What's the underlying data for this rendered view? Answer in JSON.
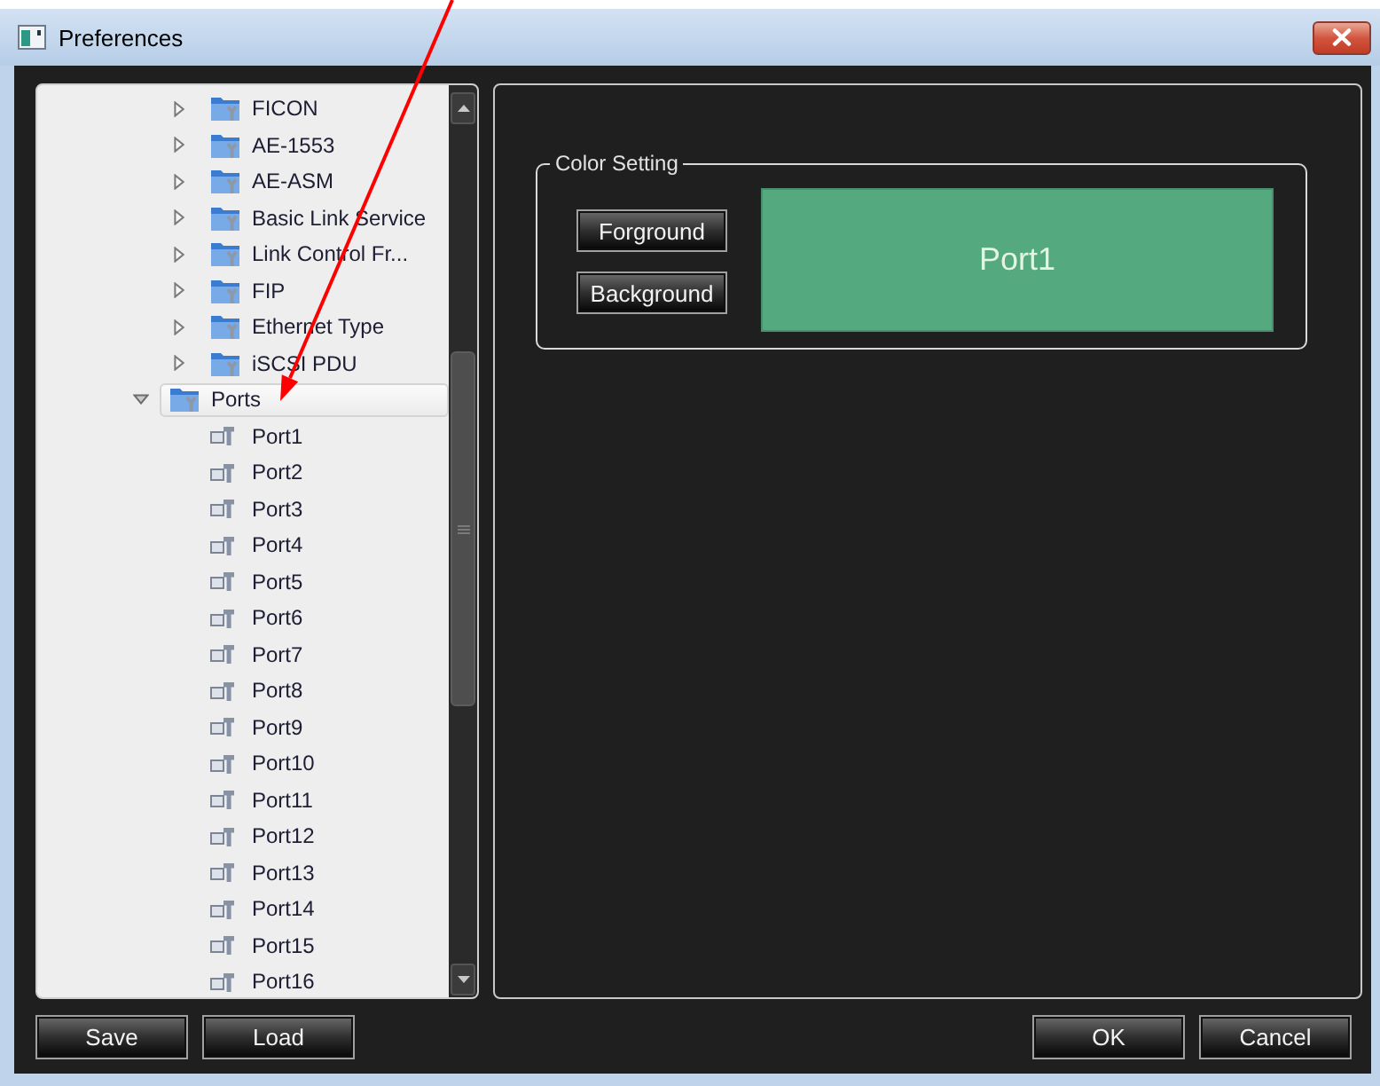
{
  "window": {
    "title": "Preferences"
  },
  "tree": {
    "items": [
      {
        "children": [
          {
            "label": "FICON",
            "kind": "folder",
            "expanded": false,
            "selected": false
          },
          {
            "label": "AE-1553",
            "kind": "folder",
            "expanded": false,
            "selected": false
          },
          {
            "label": "AE-ASM",
            "kind": "folder",
            "expanded": false,
            "selected": false
          },
          {
            "label": "Basic Link Service",
            "kind": "folder",
            "expanded": false,
            "selected": false
          },
          {
            "label": "Link Control Fr...",
            "kind": "folder",
            "expanded": false,
            "selected": false
          },
          {
            "label": "FIP",
            "kind": "folder",
            "expanded": false,
            "selected": false
          },
          {
            "label": "Ethernet Type",
            "kind": "folder",
            "expanded": false,
            "selected": false
          },
          {
            "label": "iSCSI PDU",
            "kind": "folder",
            "expanded": false,
            "selected": false
          }
        ]
      },
      {
        "label": "Ports",
        "kind": "folder",
        "expanded": true,
        "selected": true,
        "children": [
          {
            "label": "Port1",
            "kind": "port",
            "selected": false
          },
          {
            "label": "Port2",
            "kind": "port",
            "selected": false
          },
          {
            "label": "Port3",
            "kind": "port",
            "selected": false
          },
          {
            "label": "Port4",
            "kind": "port",
            "selected": false
          },
          {
            "label": "Port5",
            "kind": "port",
            "selected": false
          },
          {
            "label": "Port6",
            "kind": "port",
            "selected": false
          },
          {
            "label": "Port7",
            "kind": "port",
            "selected": false
          },
          {
            "label": "Port8",
            "kind": "port",
            "selected": false
          },
          {
            "label": "Port9",
            "kind": "port",
            "selected": false
          },
          {
            "label": "Port10",
            "kind": "port",
            "selected": false
          },
          {
            "label": "Port11",
            "kind": "port",
            "selected": false
          },
          {
            "label": "Port12",
            "kind": "port",
            "selected": false
          },
          {
            "label": "Port13",
            "kind": "port",
            "selected": false
          },
          {
            "label": "Port14",
            "kind": "port",
            "selected": false
          },
          {
            "label": "Port15",
            "kind": "port",
            "selected": false
          },
          {
            "label": "Port16",
            "kind": "port",
            "selected": false
          }
        ]
      }
    ]
  },
  "color_setting": {
    "title": "Color Setting",
    "buttons": [
      "Forground",
      "Background"
    ],
    "preview": {
      "label": "Port1",
      "color": "#55a97f"
    }
  },
  "footer": {
    "left_buttons": [
      "Save",
      "Load"
    ],
    "right_buttons": [
      "OK",
      "Cancel"
    ]
  }
}
